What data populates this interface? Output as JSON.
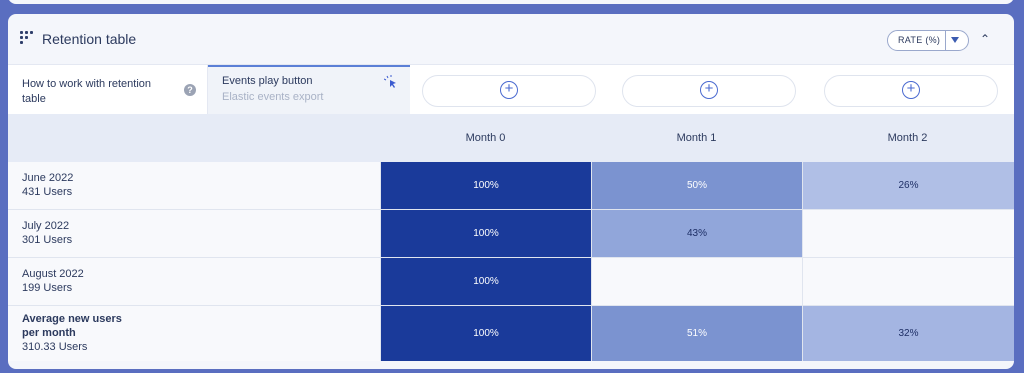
{
  "panel": {
    "title": "Retention table",
    "rate_button": "RATE (%)",
    "collapse_icon": "chevron-up-icon"
  },
  "tabs": [
    {
      "label": "How to work with retention table",
      "icon": "question-icon"
    },
    {
      "label": "Events play button",
      "sublabel": "Elastic events export",
      "icon": "pointer-icon"
    }
  ],
  "add_tab_icon": "plus-circle-icon",
  "columns": [
    "Month 0",
    "Month 1",
    "Month 2"
  ],
  "rows": [
    {
      "label": "June 2022",
      "sublabel": "431 Users",
      "values": [
        "100%",
        "50%",
        "26%"
      ]
    },
    {
      "label": "July 2022",
      "sublabel": "301 Users",
      "values": [
        "100%",
        "43%",
        ""
      ]
    },
    {
      "label": "August 2022",
      "sublabel": "199 Users",
      "values": [
        "100%",
        "",
        ""
      ]
    },
    {
      "label": "Average new users per month",
      "sublabel": "310.33 Users",
      "values": [
        "100%",
        "51%",
        "32%"
      ]
    }
  ],
  "colors": {
    "month0": "#1a3a9a",
    "heat_high": "#7b93d0",
    "heat_mid": "#91a6da",
    "heat_low": "#b0bfe6"
  }
}
